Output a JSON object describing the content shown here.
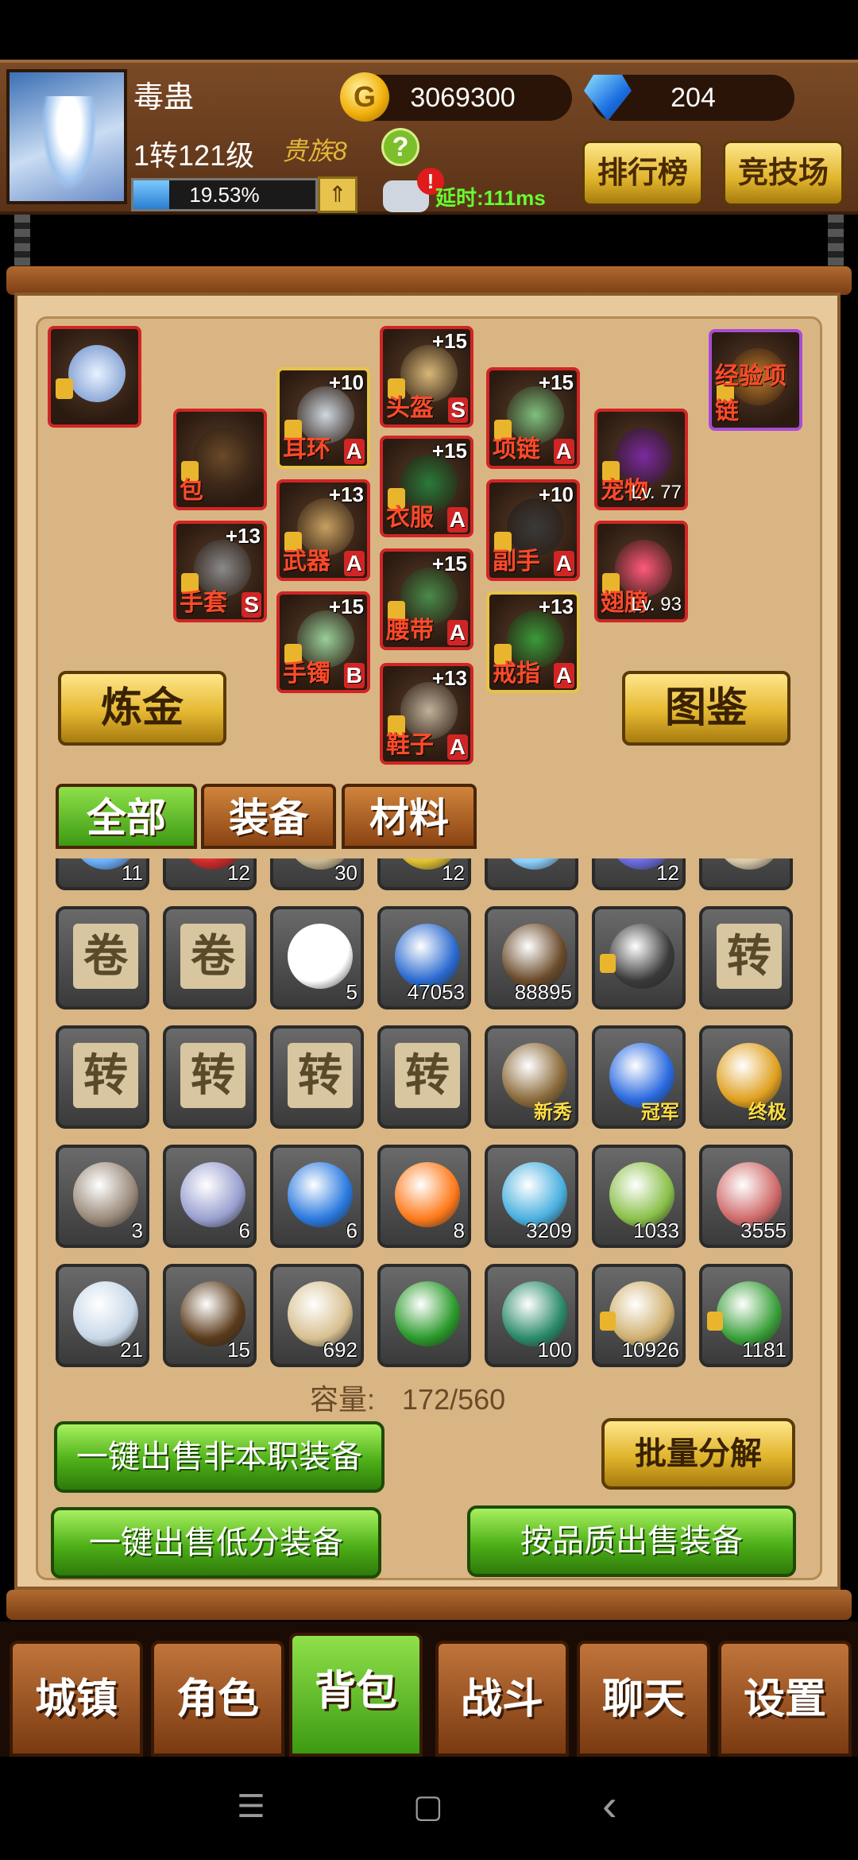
{
  "player": {
    "name": "毒蛊",
    "level": "1转121级",
    "vip": "贵族8",
    "exp_text": "19.53%",
    "exp_fraction": 0.1953,
    "latency": "延时:111ms",
    "chat_badge": "!"
  },
  "currency": {
    "gold": "3069300",
    "gems": "204",
    "gold_icon": "G"
  },
  "header_buttons": {
    "rank": "排行榜",
    "arena": "竞技场"
  },
  "help": "?",
  "exp_up": "⇑",
  "equipment": [
    {
      "slot": "头盔",
      "plus": "+15",
      "grade": "S"
    },
    {
      "slot": "耳环",
      "plus": "+10",
      "grade": "A"
    },
    {
      "slot": "项链",
      "plus": "+15",
      "grade": "A"
    },
    {
      "slot": "包",
      "plus": "",
      "grade": ""
    },
    {
      "slot": "武器",
      "plus": "+13",
      "grade": "A"
    },
    {
      "slot": "衣服",
      "plus": "+15",
      "grade": "A"
    },
    {
      "slot": "副手",
      "plus": "+10",
      "grade": "A"
    },
    {
      "slot": "宠物",
      "plus": "",
      "grade": "",
      "lvl": "Lv. 77"
    },
    {
      "slot": "手套",
      "plus": "+13",
      "grade": "S"
    },
    {
      "slot": "腰带",
      "plus": "+15",
      "grade": "A"
    },
    {
      "slot": "手镯",
      "plus": "+15",
      "grade": "B"
    },
    {
      "slot": "戒指",
      "plus": "+13",
      "grade": "A"
    },
    {
      "slot": "翅膀",
      "plus": "",
      "grade": "",
      "lvl": "Lv. 93"
    },
    {
      "slot": "鞋子",
      "plus": "+13",
      "grade": "A"
    },
    {
      "slot": "经验项链",
      "plus": "",
      "grade": ""
    }
  ],
  "actions": {
    "alchemy": "炼金",
    "codex": "图鉴"
  },
  "tabs": {
    "all": "全部",
    "equip": "装备",
    "material": "材料"
  },
  "inventory_rows": [
    [
      {
        "c": "11"
      },
      {
        "c": "12"
      },
      {
        "c": "30"
      },
      {
        "c": "12"
      },
      {
        "c": ""
      },
      {
        "c": "12"
      },
      {
        "c": ""
      }
    ],
    [
      {
        "c": "",
        "g": "卷"
      },
      {
        "c": "",
        "g": "卷"
      },
      {
        "c": "5"
      },
      {
        "c": "47053"
      },
      {
        "c": "88895"
      },
      {
        "c": "",
        "lock": true
      },
      {
        "c": "",
        "g": "转"
      }
    ],
    [
      {
        "c": "",
        "g": "转"
      },
      {
        "c": "",
        "g": "转"
      },
      {
        "c": "",
        "g": "转"
      },
      {
        "c": "",
        "g": "转"
      },
      {
        "c": "",
        "n": "新秀"
      },
      {
        "c": "",
        "n": "冠军"
      },
      {
        "c": "",
        "n": "终极"
      }
    ],
    [
      {
        "c": "3"
      },
      {
        "c": "6"
      },
      {
        "c": "6"
      },
      {
        "c": "8"
      },
      {
        "c": "3209"
      },
      {
        "c": "1033"
      },
      {
        "c": "3555"
      }
    ],
    [
      {
        "c": "21"
      },
      {
        "c": "15"
      },
      {
        "c": "692"
      },
      {
        "c": ""
      },
      {
        "c": "100"
      },
      {
        "c": "10926",
        "lock": true
      },
      {
        "c": "1181",
        "lock": true
      }
    ]
  ],
  "capacity": {
    "label": "容量:",
    "value": "172/560"
  },
  "buttons": {
    "sell_nonclass": "一键出售非本职装备",
    "batch_decompose": "批量分解",
    "sell_low": "一键出售低分装备",
    "sell_quality": "按品质出售装备"
  },
  "nav": [
    "城镇",
    "角色",
    "背包",
    "战斗",
    "聊天",
    "设置"
  ],
  "system": {
    "menu": "☰",
    "home": "▢",
    "back": "‹"
  },
  "colors": {
    "gold_btn": "#e0b42c",
    "green_btn": "#4eb018",
    "slot_border": "#d12525",
    "panel": "#e7c99c"
  }
}
